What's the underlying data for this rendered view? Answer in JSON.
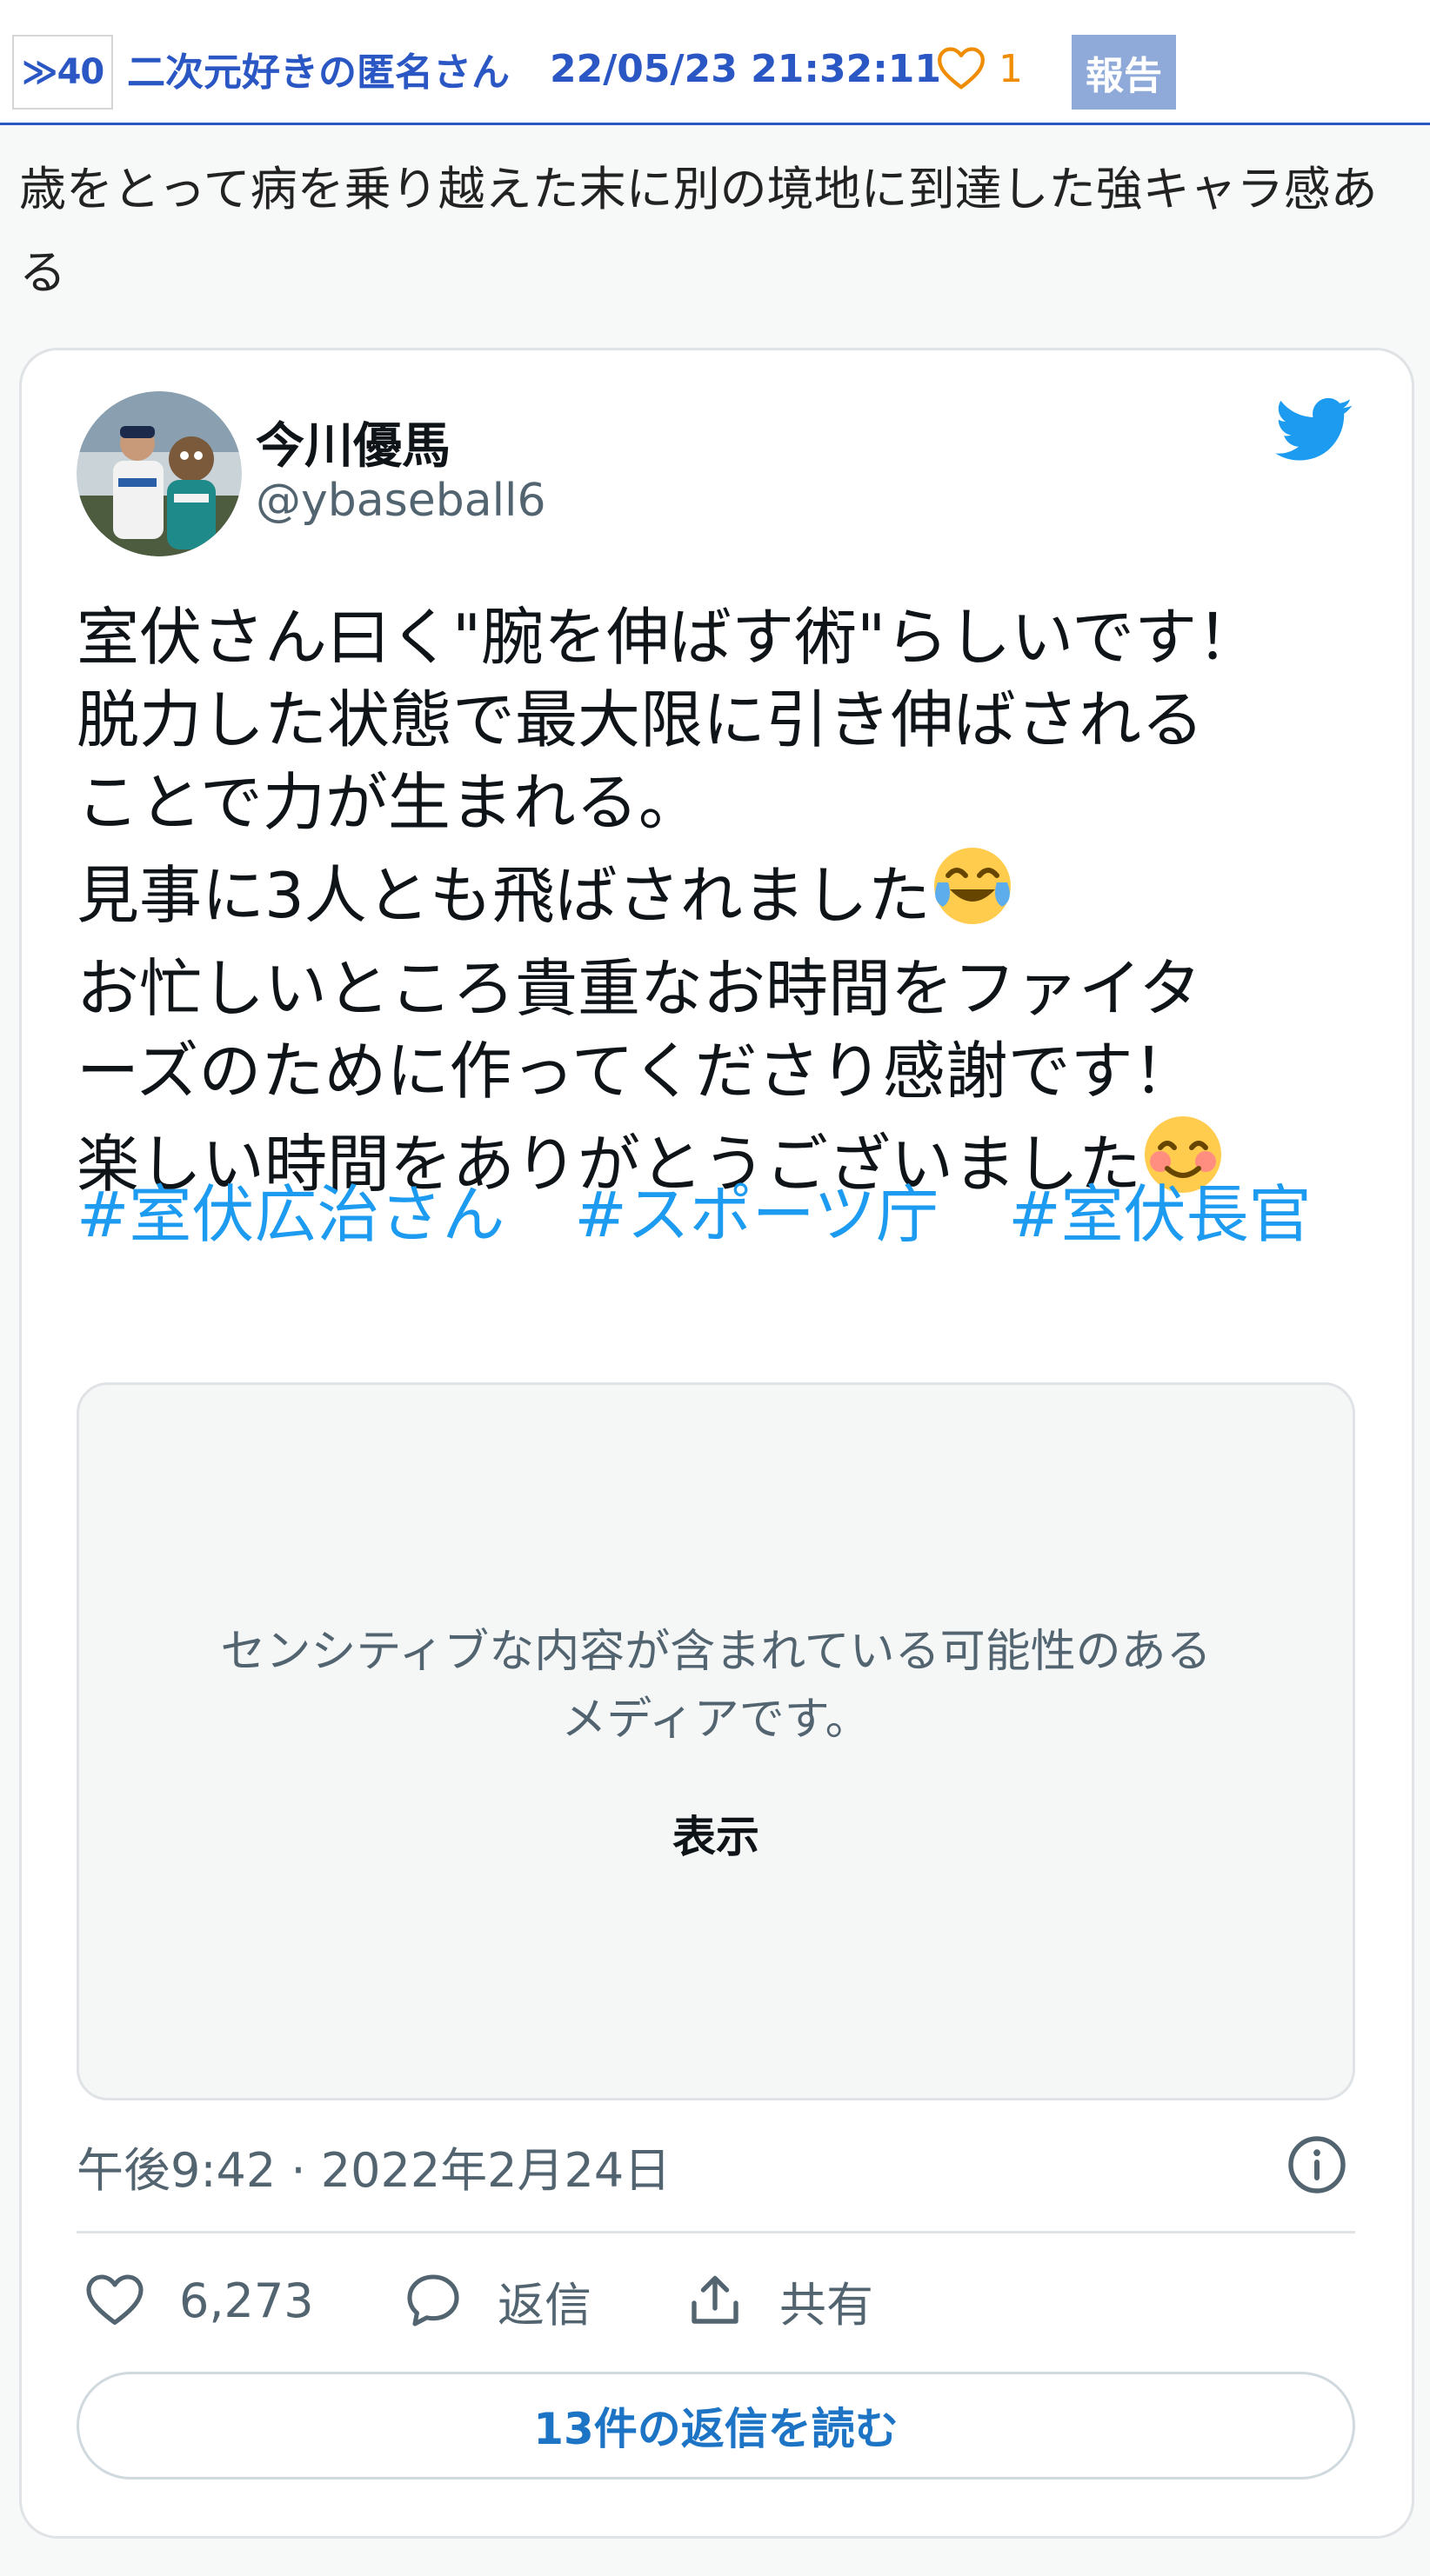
{
  "post": {
    "number": "≫40",
    "poster_name": "二次元好きの匿名さん",
    "date": "22/05/23  21:32:11",
    "like_count": "1",
    "report_label": "報告",
    "body": "歳をとって病を乗り越えた末に別の境地に到達した強キャラ感ある"
  },
  "tweet": {
    "author_name": "今川優馬",
    "author_handle": "@ybaseball6",
    "text_lines": [
      "室伏さん曰く\"腕を伸ばす術\"らしいです！",
      "脱力した状態で最大限に引き伸ばされる",
      "ことで力が生まれる。",
      "見事に3人とも飛ばされました",
      "お忙しいところ貴重なお時間をファイタ",
      "ーズのために作ってくださり感謝です！",
      "楽しい時間をありがとうございました"
    ],
    "emoji": [
      "face-with-tears-of-joy-icon",
      "smiling-face-with-smiling-eyes-icon"
    ],
    "hashtags": [
      "#室伏広治さん",
      "#スポーツ庁",
      "#室伏長官"
    ],
    "media_warning": "センシティブな内容が含まれている可能性のある\nメディアです。",
    "media_show_label": "表示",
    "timestamp": "午後9:42 · 2022年2月24日",
    "like_count": "6,273",
    "reply_label": "返信",
    "share_label": "共有",
    "read_replies_label": "13件の返信を読む",
    "colors": {
      "link": "#1d9bf0",
      "twitter_blue": "#1d9bf0",
      "post_header_blue": "#2a57c4",
      "like_orange": "#f08c00"
    }
  }
}
